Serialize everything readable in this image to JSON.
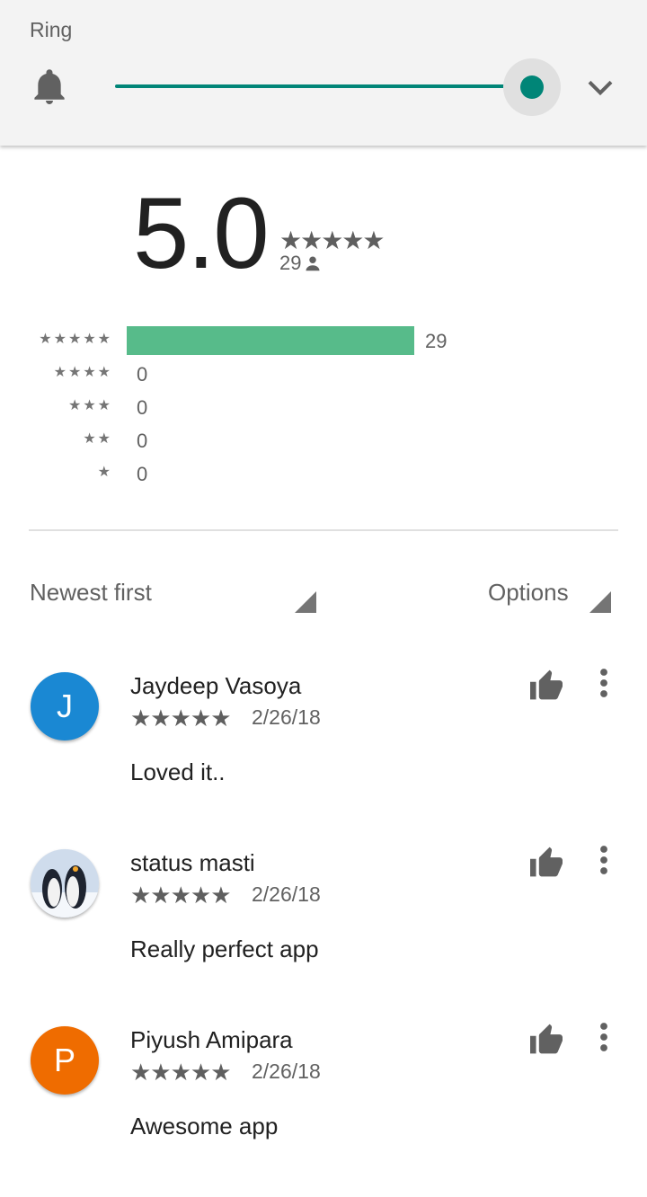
{
  "volume": {
    "label": "Ring",
    "level_fraction": 1.0,
    "icon": "bell-icon",
    "expand_icon": "chevron-down-icon",
    "accent": "#008577"
  },
  "summary": {
    "average": "5.0",
    "stars": "★★★★★",
    "count": "29"
  },
  "histogram": [
    {
      "stars": "★★★★★",
      "count": "29",
      "fraction": 1.0
    },
    {
      "stars": "★★★★",
      "count": "0",
      "fraction": 0
    },
    {
      "stars": "★★★",
      "count": "0",
      "fraction": 0
    },
    {
      "stars": "★★",
      "count": "0",
      "fraction": 0
    },
    {
      "stars": "★",
      "count": "0",
      "fraction": 0
    }
  ],
  "histogram_bar_color": "#57bb8a",
  "sort": {
    "label": "Newest first"
  },
  "options": {
    "label": "Options"
  },
  "reviews": [
    {
      "name": "Jaydeep Vasoya",
      "initial": "J",
      "avatar_color": "#1a88d3",
      "stars": "★★★★★",
      "date": "2/26/18",
      "text": "Loved it.."
    },
    {
      "name": "status masti",
      "initial": "",
      "avatar_color": "#e8eef6",
      "stars": "★★★★★",
      "date": "2/26/18",
      "text": "Really perfect app"
    },
    {
      "name": "Piyush Amipara",
      "initial": "P",
      "avatar_color": "#ef6c00",
      "stars": "★★★★★",
      "date": "2/26/18",
      "text": "Awesome app"
    }
  ]
}
